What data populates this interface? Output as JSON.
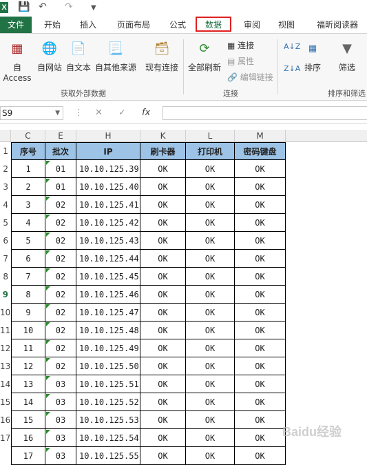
{
  "qat": {
    "app_icon": "X",
    "icons": [
      "save-icon",
      "undo-icon",
      "redo-icon",
      "customize-icon"
    ]
  },
  "tabs": [
    "文件",
    "开始",
    "插入",
    "页面布局",
    "公式",
    "数据",
    "审阅",
    "视图",
    "福昕阅读器"
  ],
  "ribbon": {
    "get_external": {
      "buttons": [
        "自 Access",
        "自网站",
        "自文本",
        "自其他来源",
        "现有连接"
      ],
      "group_label": "获取外部数据"
    },
    "connections": {
      "refresh_all": "全部刷新",
      "connections": "连接",
      "properties": "属性",
      "edit_links": "编辑链接",
      "group_label": "连接"
    },
    "sort_filter": {
      "sort": "排序",
      "filter": "筛选",
      "group_label": "排序和筛选"
    }
  },
  "formula_bar": {
    "name_box": "S9",
    "fx": "fx",
    "value": ""
  },
  "grid": {
    "columns": [
      "C",
      "E",
      "H",
      "K",
      "L",
      "M"
    ],
    "row_numbers": [
      "1",
      "2",
      "3",
      "4",
      "5",
      "6",
      "7",
      "8",
      "9",
      "10",
      "11",
      "12",
      "13",
      "14",
      "15",
      "16",
      "17"
    ],
    "selected_row": "9",
    "headers": [
      "序号",
      "批次",
      "IP",
      "刷卡器",
      "打印机",
      "密码键盘"
    ],
    "rows": [
      [
        "1",
        "01",
        "10.10.125.39",
        "OK",
        "OK",
        "OK"
      ],
      [
        "2",
        "01",
        "10.10.125.40",
        "OK",
        "OK",
        "OK"
      ],
      [
        "3",
        "02",
        "10.10.125.41",
        "OK",
        "OK",
        "OK"
      ],
      [
        "4",
        "02",
        "10.10.125.42",
        "OK",
        "OK",
        "OK"
      ],
      [
        "5",
        "02",
        "10.10.125.43",
        "OK",
        "OK",
        "OK"
      ],
      [
        "6",
        "02",
        "10.10.125.44",
        "OK",
        "OK",
        "OK"
      ],
      [
        "7",
        "02",
        "10.10.125.45",
        "OK",
        "OK",
        "OK"
      ],
      [
        "8",
        "02",
        "10.10.125.46",
        "OK",
        "OK",
        "OK"
      ],
      [
        "9",
        "02",
        "10.10.125.47",
        "OK",
        "OK",
        "OK"
      ],
      [
        "10",
        "02",
        "10.10.125.48",
        "OK",
        "OK",
        "OK"
      ],
      [
        "11",
        "02",
        "10.10.125.49",
        "OK",
        "OK",
        "OK"
      ],
      [
        "12",
        "02",
        "10.10.125.50",
        "OK",
        "OK",
        "OK"
      ],
      [
        "13",
        "03",
        "10.10.125.51",
        "OK",
        "OK",
        "OK"
      ],
      [
        "14",
        "03",
        "10.10.125.52",
        "OK",
        "OK",
        "OK"
      ],
      [
        "15",
        "03",
        "10.10.125.53",
        "OK",
        "OK",
        "OK"
      ],
      [
        "16",
        "03",
        "10.10.125.54",
        "OK",
        "OK",
        "OK"
      ],
      [
        "17",
        "03",
        "10.10.125.55",
        "OK",
        "OK",
        "OK"
      ]
    ]
  },
  "colors": {
    "excel_green": "#217346",
    "header_fill": "#9dc3e6",
    "highlight": "#e02020"
  },
  "watermark": "Baidu经验"
}
